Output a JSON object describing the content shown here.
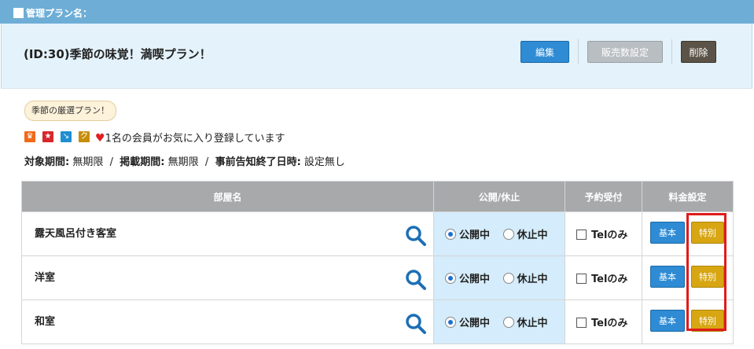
{
  "topbar": {
    "title": "管理プラン名："
  },
  "plan": {
    "title": "(ID:30)季節の味覚！満喫プラン！",
    "buttons": {
      "edit": "編集",
      "sales": "販売数設定",
      "delete": "削除"
    },
    "tag": "季節の厳選プラン！",
    "badge_icons": [
      {
        "name": "crown-icon",
        "glyph": "♛",
        "color": "#f06a1a"
      },
      {
        "name": "star-icon",
        "glyph": "★",
        "color": "#d7262c"
      },
      {
        "name": "arrow-icon",
        "glyph": "↘",
        "color": "#1f8fd2"
      },
      {
        "name": "coupon-icon",
        "glyph": "ク",
        "color": "#c78e0a"
      }
    ],
    "favorite_text": "1名の会員がお気に入り登録しています",
    "periods": {
      "target_label": "対象期間:",
      "target_value": "無期限",
      "post_label": "掲載期間:",
      "post_value": "無期限",
      "notice_label": "事前告知終了日時:",
      "notice_value": "設定無し",
      "separator": "/"
    }
  },
  "table": {
    "headers": [
      "部屋名",
      "公開/休止",
      "予約受付",
      "料金設定"
    ],
    "rows": [
      {
        "name": "露天風呂付き客室",
        "public": "公開中",
        "pause": "休止中",
        "tel": "Telのみ",
        "basic": "基本",
        "special": "特別"
      },
      {
        "name": "洋室",
        "public": "公開中",
        "pause": "休止中",
        "tel": "Telのみ",
        "basic": "基本",
        "special": "特別"
      },
      {
        "name": "和室",
        "public": "公開中",
        "pause": "休止中",
        "tel": "Telのみ",
        "basic": "基本",
        "special": "特別"
      }
    ]
  }
}
